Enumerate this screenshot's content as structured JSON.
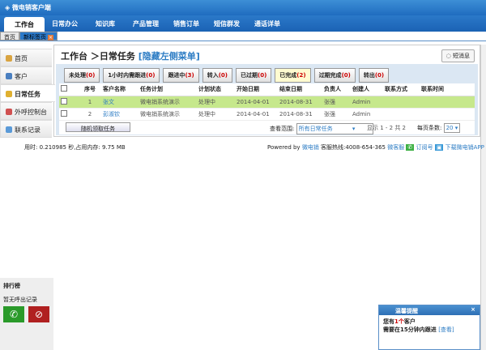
{
  "app": {
    "title": "微电销客户端"
  },
  "nav": [
    "工作台",
    "日常办公",
    "知识库",
    "产品管理",
    "销售订单",
    "短信群发",
    "通话详单"
  ],
  "tabs": [
    "首页",
    "新标签页"
  ],
  "sidebar": [
    "首页",
    "客户",
    "日常任务",
    "外呼控制台",
    "联系记录"
  ],
  "header": {
    "title": "工作台 ＞日常任务",
    "hide_link": "[隐藏左侧菜单]",
    "sms": "短消息"
  },
  "filters": [
    {
      "label": "未处理",
      "count": "(0)"
    },
    {
      "label": "1小时内需跟进",
      "count": "(0)"
    },
    {
      "label": "跟进中",
      "count": "(3)"
    },
    {
      "label": "转入",
      "count": "(0)"
    },
    {
      "label": "已过期",
      "count": "(0)"
    },
    {
      "label": "已完成",
      "count": "(2)"
    },
    {
      "label": "过期完成",
      "count": "(0)"
    },
    {
      "label": "转出",
      "count": "(0)"
    }
  ],
  "table": {
    "columns": [
      "序号",
      "客户名称",
      "任务计划",
      "计划状态",
      "开始日期",
      "结束日期",
      "负责人",
      "创建人",
      "联系方式",
      "联系时间"
    ],
    "rows": [
      [
        "1",
        "张文",
        "微电销系统演示",
        "处理中",
        "2014-04-01",
        "2014-08-31",
        "张强",
        "Admin",
        "",
        ""
      ],
      [
        "2",
        "彭淑钦",
        "微电销系统演示",
        "处理中",
        "2014-04-01",
        "2014-08-31",
        "张强",
        "Admin",
        "",
        ""
      ]
    ]
  },
  "footer": {
    "random_btn": "随机领取任务",
    "range_label": "查看范围:",
    "range_value": "所有日常任务",
    "display": "显示 1 - 2 共 2",
    "per_page_label": "每页条数:",
    "per_page": "20"
  },
  "status": "用时: 0.210985 秒,占用内存: 9.75 MB",
  "powered": {
    "prefix": "Powered by",
    "brand": "微电销",
    "hotline": "客服热线:4008-654-365",
    "service": "微客服",
    "subscribe": "订阅号",
    "app": "下载微电销APP"
  },
  "rank": {
    "title": "排行榜",
    "empty": "暂无呼出记录"
  },
  "popup": {
    "title": "温馨提醒",
    "line1a": "您有",
    "count": "1个",
    "line1b": "客户",
    "line2": "需要在15分钟内跟进",
    "view": "[查看]"
  }
}
